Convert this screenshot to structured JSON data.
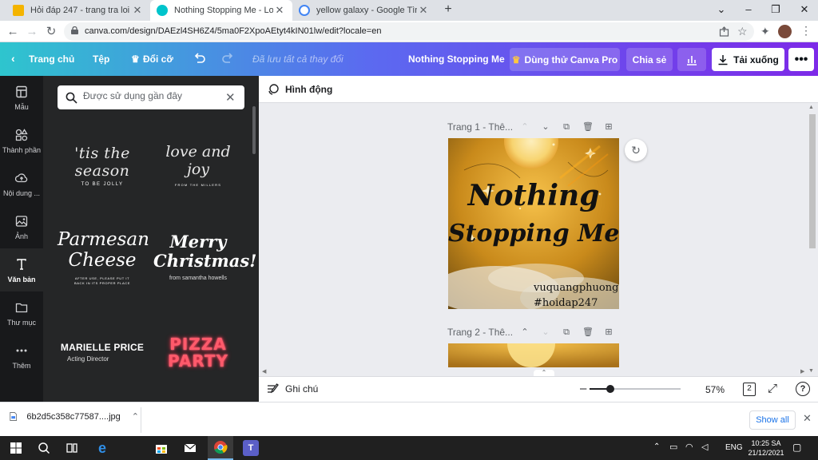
{
  "browser": {
    "tabs": [
      {
        "title": "Hỏi đáp 247 - trang tra loi",
        "active": false
      },
      {
        "title": "Nothing Stopping Me - Logo",
        "active": true
      },
      {
        "title": "yellow galaxy - Google Tìm kiếm",
        "active": false
      }
    ],
    "url": "canva.com/design/DAEzl4SH6Z4/5ma0F2XpoAEtyt4kIN01lw/edit?locale=en"
  },
  "canva_header": {
    "home": "Trang chủ",
    "file": "Tệp",
    "resize": "Đổi cỡ",
    "save_status": "Đã lưu tất cả thay đổi",
    "design_title": "Nothing Stopping Me",
    "try_pro": "Dùng thử Canva Pro",
    "share": "Chia sẻ",
    "download": "Tải xuống"
  },
  "rail": [
    {
      "label": "Mẫu",
      "icon": "template-icon"
    },
    {
      "label": "Thành phần",
      "icon": "elements-icon"
    },
    {
      "label": "Nội dung ...",
      "icon": "upload-icon"
    },
    {
      "label": "Ảnh",
      "icon": "photo-icon"
    },
    {
      "label": "Văn bản",
      "icon": "text-icon"
    },
    {
      "label": "Thư mục",
      "icon": "folder-icon"
    },
    {
      "label": "Thêm",
      "icon": "more-icon"
    }
  ],
  "panel": {
    "search_placeholder": "Được sử dụng gần đây",
    "templates": [
      {
        "main": "'tis the season",
        "sub": "TO BE JOLLY"
      },
      {
        "main": "love and joy",
        "sub": "FROM THE MILLERS"
      },
      {
        "main1": "Parmesan",
        "main2": "Cheese",
        "sub": "AFTER USE, PLEASE PUT IT BACK IN ITS PROPER PLACE"
      },
      {
        "main1": "Merry",
        "main2": "Christmas!",
        "sub": "from samantha howells"
      },
      {
        "main": "MARIELLE PRICE",
        "sub": "Acting Director"
      },
      {
        "main1": "PIZZA",
        "main2": "PARTY"
      }
    ]
  },
  "editor": {
    "animate": "Hình động",
    "page1_title": "Trang 1 - Thê...",
    "page2_title": "Trang 2 - Thê...",
    "design_line1": "Nothing",
    "design_line2": "Stopping Me",
    "handle": "vuquangphuong",
    "hashtag": "#hoidap247",
    "notes": "Ghi chú",
    "zoom": "57%",
    "zoom_fraction": 0.57,
    "page_count": "2"
  },
  "shelf": {
    "file": "6b2d5c358c77587....jpg",
    "show_all": "Show all"
  },
  "taskbar": {
    "lang": "ENG",
    "time": "10:25 SA",
    "date": "21/12/2021"
  }
}
